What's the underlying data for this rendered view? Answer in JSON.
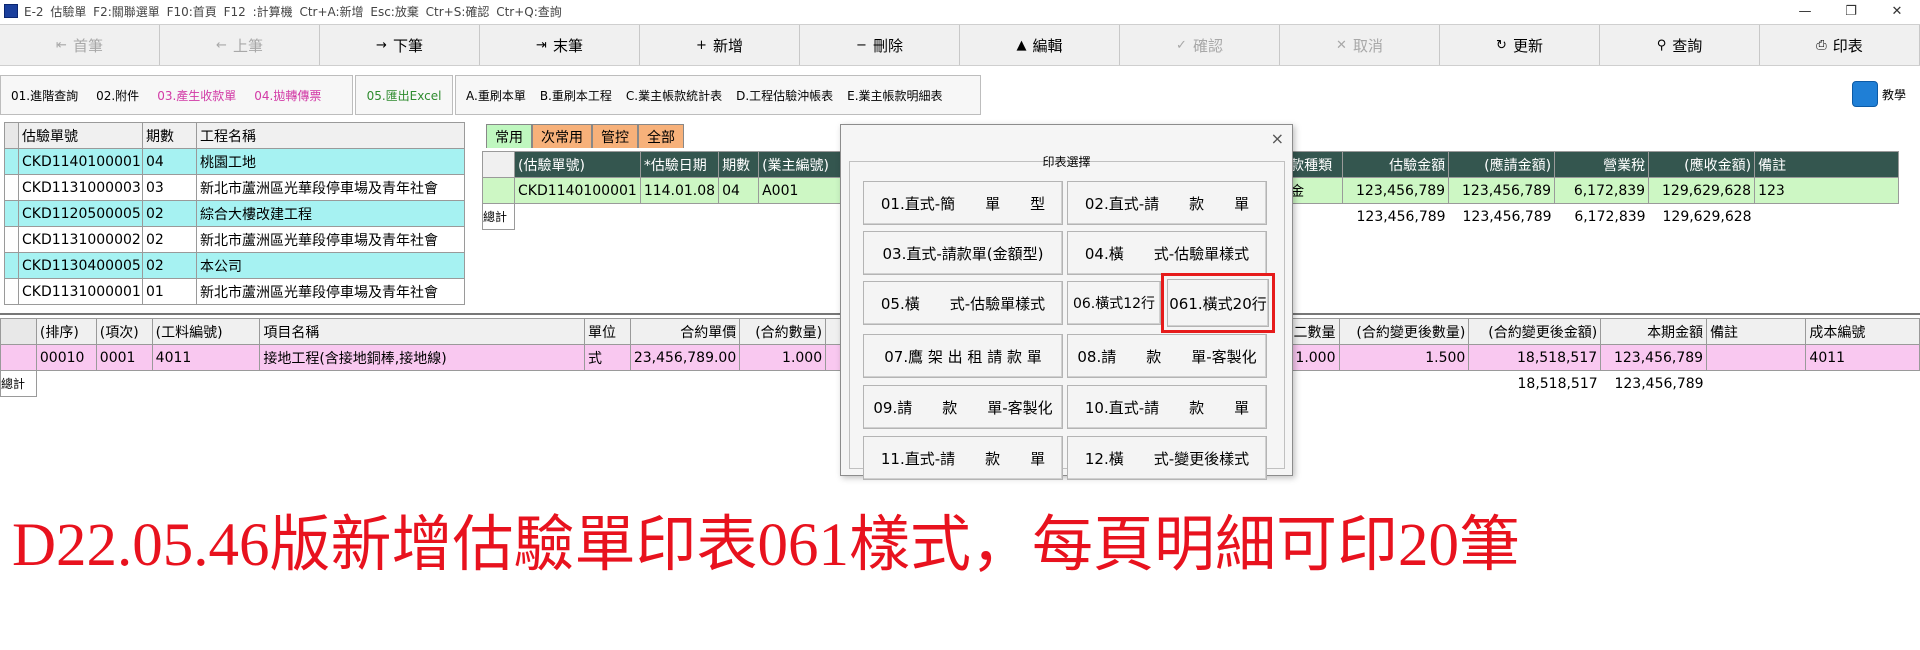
{
  "window": {
    "title": "E-2 估驗單   F2:關聯選單  F10:首頁   F12 :計算機   Ctr+A:新增   Esc:放棄   Ctr+S:確認   Ctr+Q:查詢",
    "minimize": "—",
    "restore": "❐",
    "close": "✕"
  },
  "toolbar": [
    {
      "label": "首筆",
      "icon": "⇤",
      "enabled": false,
      "name": "first-record-button"
    },
    {
      "label": "上筆",
      "icon": "←",
      "enabled": false,
      "name": "prev-record-button"
    },
    {
      "label": "下筆",
      "icon": "→",
      "enabled": true,
      "name": "next-record-button"
    },
    {
      "label": "末筆",
      "icon": "⇥",
      "enabled": true,
      "name": "last-record-button"
    },
    {
      "label": "新增",
      "icon": "+",
      "enabled": true,
      "name": "add-button"
    },
    {
      "label": "刪除",
      "icon": "−",
      "enabled": true,
      "name": "delete-button"
    },
    {
      "label": "編輯",
      "icon": "▲",
      "enabled": true,
      "name": "edit-button"
    },
    {
      "label": "確認",
      "icon": "✓",
      "enabled": false,
      "name": "confirm-button"
    },
    {
      "label": "取消",
      "icon": "✕",
      "enabled": false,
      "name": "cancel-button"
    },
    {
      "label": "更新",
      "icon": "↻",
      "enabled": true,
      "name": "refresh-button"
    },
    {
      "label": "查詢",
      "icon": "⚲",
      "enabled": true,
      "name": "query-button"
    },
    {
      "label": "印表",
      "icon": "⎙",
      "enabled": true,
      "name": "print-button"
    }
  ],
  "functions": {
    "adv_query": "01.進階查詢",
    "attach": "02.附件",
    "gen_receipt": "03.產生收款單",
    "transfer_invoice": "04.拋轉傳票",
    "export_excel": "05.匯出Excel",
    "reprint_a": "A.重刷本單",
    "reprint_b": "B.重刷本工程",
    "stat_c": "C.業主帳款統計表",
    "offset_d": "D.工程估驗沖帳表",
    "detail_e": "E.業主帳款明細表",
    "teach": "教學"
  },
  "left_grid": {
    "headers": [
      "估驗單號",
      "期數",
      "工程名稱"
    ],
    "rows": [
      [
        "CKD1140100001",
        "04",
        "桃園工地"
      ],
      [
        "CKD1131000003",
        "03",
        "新北市蘆洲區光華段停車場及青年社會"
      ],
      [
        "CKD1120500005",
        "02",
        "綜合大樓改建工程"
      ],
      [
        "CKD1131000002",
        "02",
        "新北市蘆洲區光華段停車場及青年社會"
      ],
      [
        "CKD1130400005",
        "02",
        "本公司"
      ],
      [
        "CKD1131000001",
        "01",
        "新北市蘆洲區光華段停車場及青年社會"
      ]
    ]
  },
  "tabs": [
    "常用",
    "次常用",
    "管控",
    "全部"
  ],
  "right_grid": {
    "headers_left": [
      "(估驗單號)",
      "*估驗日期",
      "期數",
      "(業主編號)"
    ],
    "headers_right": [
      "款種類",
      "估驗金額",
      "(應請金額)",
      "營業稅",
      "(應收金額)",
      "備註"
    ],
    "row_left": [
      "CKD1140100001",
      "114.01.08",
      "04",
      "A001"
    ],
    "row_right": [
      "金",
      "123,456,789",
      "123,456,789",
      "6,172,839",
      "129,629,628",
      "123"
    ],
    "sum_label": "總計",
    "sum_right": [
      "",
      "123,456,789",
      "123,456,789",
      "6,172,839",
      "129,629,628",
      ""
    ]
  },
  "detail_grid": {
    "headers_left": [
      "(排序)",
      "(項次)",
      "(工料編號)",
      "項目名稱",
      "單位",
      "合約單價",
      "(合約數量)"
    ],
    "headers_right": [
      "二數量",
      "(合約變更後數量)",
      "(合約變更後金額)",
      "本期金額",
      "備註",
      "成本編號"
    ],
    "row_left": [
      "00010",
      "0001",
      "4011",
      "接地工程(含接地銅棒,接地線)",
      "式",
      "23,456,789.00",
      "1.000"
    ],
    "row_right": [
      "1.000",
      "1.500",
      "18,518,517",
      "123,456,789",
      "",
      "4011"
    ],
    "sum_label": "總計",
    "sum_right": [
      "",
      "",
      "18,518,517",
      "123,456,789",
      "",
      ""
    ]
  },
  "dialog": {
    "title": "印表選擇",
    "close": "×",
    "buttons": [
      "01.直式-簡　　單　　型",
      "02.直式-請　　款　　單",
      "03.直式-請款單(金額型)",
      "04.橫　　式-估驗單樣式",
      "05.橫　　式-估驗單樣式",
      "06.橫式12行",
      "061.橫式20行",
      "07.鷹 架 出 租 請 款 單",
      "08.請　　款　　單-客製化",
      "09.請　　款　　單-客製化",
      "10.直式-請　　款　　單",
      "11.直式-請　　款　　單",
      "12.橫　　式-變更後樣式"
    ]
  },
  "annotation": "D22.05.46版新增估驗單印表061樣式，每頁明細可印20筆",
  "colors": {
    "annotation": "#e8121e",
    "highlight": "#e61b1b",
    "grid_header_dark": "#34564f",
    "cyan_row": "#a6f2f2",
    "green_row": "#cdf7c4",
    "pink_row": "#f9c8f0"
  }
}
